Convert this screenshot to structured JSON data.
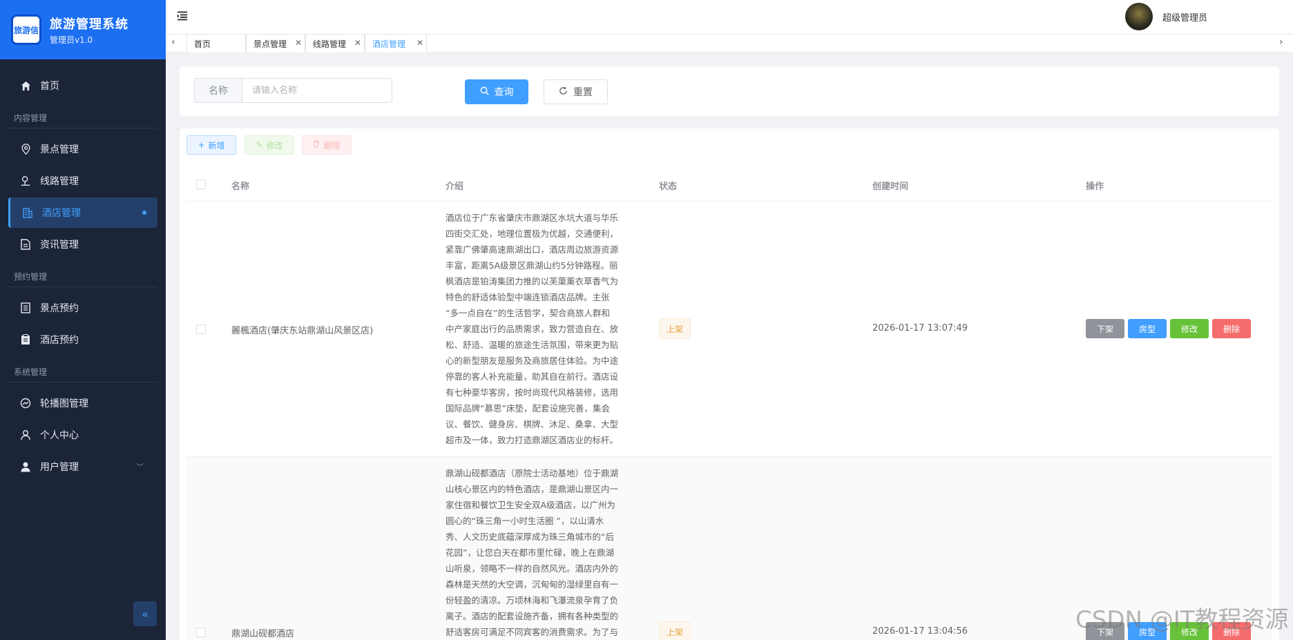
{
  "brand": {
    "logo_text": "旅游信",
    "title": "旅游管理系统",
    "subtitle": "管理员v1.0",
    "color": "#1d6ff2"
  },
  "sidebar": {
    "home": "首页",
    "groups": [
      {
        "title": "内容管理",
        "items": [
          "景点管理",
          "线路管理",
          "酒店管理",
          "资讯管理"
        ]
      },
      {
        "title": "预约管理",
        "items": [
          "景点预约",
          "酒店预约"
        ]
      },
      {
        "title": "系统管理",
        "items": [
          "轮播图管理",
          "个人中心",
          "用户管理"
        ]
      }
    ],
    "active": "酒店管理",
    "collapse_icon": "double-chevron-left-icon"
  },
  "header": {
    "menu_icon": "hamburger-icon",
    "username": "超级管理员"
  },
  "tabs": [
    {
      "label": "首页",
      "closable": false
    },
    {
      "label": "景点管理",
      "closable": true
    },
    {
      "label": "线路管理",
      "closable": true
    },
    {
      "label": "酒店管理",
      "closable": true,
      "active": true
    }
  ],
  "search": {
    "label": "名称",
    "placeholder": "请输入名称",
    "search_button": "查询",
    "reset_button": "重置"
  },
  "toolbar": {
    "add": "新增",
    "edit": "修改",
    "delete": "删除"
  },
  "table": {
    "columns": [
      "名称",
      "介绍",
      "状态",
      "创建时间",
      "操作"
    ],
    "actions": [
      "下架",
      "房型",
      "修改",
      "删除"
    ],
    "rows": [
      {
        "name": "麗楓酒店(肇庆东站鼎湖山风景区店)",
        "intro_lines": [
          "酒店位于广东省肇庆市鼎湖区水坑大道与华乐",
          "四街交汇处，地理位置极为优越，交通便利，",
          "紧靠广佛肇高速鼎湖出口，酒店周边旅游资源",
          "丰富，距离5A级景区鼎湖山约5分钟路程。丽",
          "枫酒店是铂涛集团力推的以芙蕖薰衣草香气为",
          "特色的舒适体验型中端连锁酒店品牌。主张",
          "“多一点自在”的生活哲学，契合商旅人群和",
          "中产家庭出行的品质需求，致力营造自在、放",
          "松、舒适、温暖的旅途生活氛围，带来更为贴",
          "心的新型朋友是服务及商旅居住体验。为中途",
          "停靠的客人补充能量，助其自在前行。酒店设",
          "有七种豪华客房，按时尚现代风格装修，选用",
          "国际品牌“慕思”床垫，配套设施完善，集会",
          "议、餐饮、健身房、棋牌、沐足、桑拿、大型",
          "超市及一体，致力打造鼎湖区酒店业的标杆。"
        ],
        "status": "上架",
        "created": "2026-01-17 13:07:49"
      },
      {
        "name": "鼎湖山砚都酒店",
        "intro_lines": [
          "鼎湖山砚都酒店（原院士活动基地）位于鼎湖",
          "山核心景区内的特色酒店，是鼎湖山景区内一",
          "家住宿和餐饮卫生安全双A级酒店，以广州为",
          "圆心的“珠三角一小时生活圈 ”，以山清水",
          "秀、人文历史底蕴深厚成为珠三角城市的“后",
          "花园”，让您白天在都市里忙碌，晚上在鼎湖",
          "山听泉，领略不一样的自然风光。酒店内外的",
          "森林是天然的大空调，沉甸甸的湿绿里自有一",
          "份轻盈的清凉。万顷林海和飞瀑流泉孕育了负",
          "离子。酒店的配套设施齐备，拥有各种类型的",
          "舒适客房可满足不同宾客的消费需求。为了与"
        ],
        "status": "上架",
        "created": "2026-01-17 13:04:56"
      }
    ]
  },
  "watermark": "CSDN @IT教程资源"
}
